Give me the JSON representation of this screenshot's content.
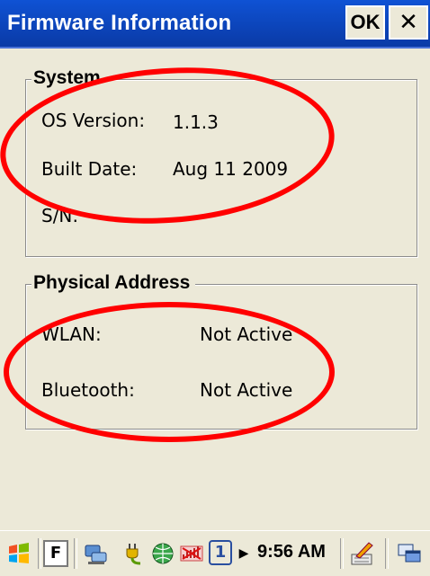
{
  "window": {
    "title": "Firmware Information",
    "ok_label": "OK",
    "close_label": "✕"
  },
  "system": {
    "title": "System",
    "rows": [
      {
        "label": "OS Version:",
        "value": "1.1.3"
      },
      {
        "label": "Built Date:",
        "value": "Aug 11 2009"
      },
      {
        "label": "S/N:",
        "value": ""
      }
    ]
  },
  "physical": {
    "title": "Physical Address",
    "rows": [
      {
        "label": "WLAN:",
        "value": "Not Active"
      },
      {
        "label": "Bluetooth:",
        "value": "Not Active"
      }
    ]
  },
  "taskbar": {
    "input_label": "F",
    "clock": "9:56 AM",
    "icons": [
      "windows-start-icon",
      "input-method-icon",
      "network-icon",
      "power-plug-icon",
      "globe-icon",
      "signal-icon",
      "profile-1-icon",
      "keyboard-pen-icon",
      "desktop-icon"
    ]
  },
  "annotation_color": "#ff0000"
}
